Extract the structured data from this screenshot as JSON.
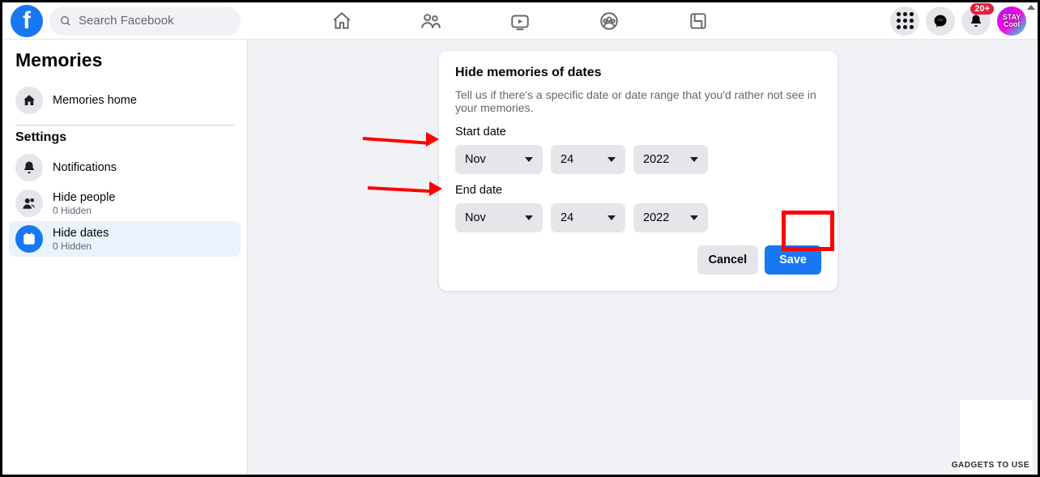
{
  "search": {
    "placeholder": "Search Facebook"
  },
  "notifications_badge": "20+",
  "avatar_text": "STAY\nCool",
  "sidebar": {
    "title": "Memories",
    "home_label": "Memories home",
    "settings_heading": "Settings",
    "items": [
      {
        "label": "Notifications",
        "sub": ""
      },
      {
        "label": "Hide people",
        "sub": "0 Hidden"
      },
      {
        "label": "Hide dates",
        "sub": "0 Hidden"
      }
    ]
  },
  "card": {
    "title": "Hide memories of dates",
    "desc": "Tell us if there's a specific date or date range that you'd rather not see in your memories.",
    "start_label": "Start date",
    "end_label": "End date",
    "start": {
      "month": "Nov",
      "day": "24",
      "year": "2022"
    },
    "end": {
      "month": "Nov",
      "day": "24",
      "year": "2022"
    },
    "cancel_label": "Cancel",
    "save_label": "Save"
  },
  "watermark": "GADGETS TO USE"
}
